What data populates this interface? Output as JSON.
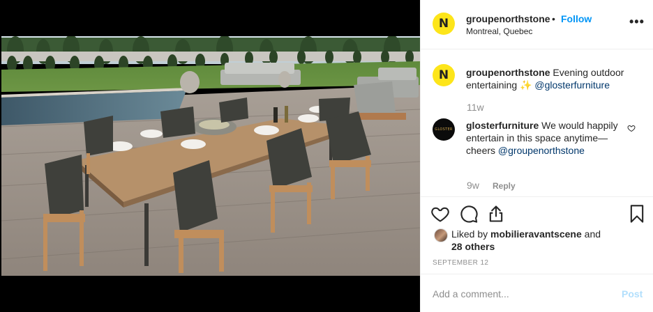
{
  "post": {
    "username": "groupenorthstone",
    "separator": "•",
    "follow_label": "Follow",
    "location": "Montreal, Quebec",
    "more_icon": "ellipsis-icon",
    "more_label": "•••",
    "avatar_letter": "N",
    "avatar_color": "#fde51a",
    "image": "outdoor-dining-table-photo"
  },
  "caption": {
    "username": "groupenorthstone",
    "text": " Evening outdoor entertaining ✨ ",
    "mention": "@glosterfurniture",
    "time": "11w"
  },
  "comments": [
    {
      "username": "glosterfurniture",
      "avatar_label": "GLOSTER",
      "text": " We would happily entertain in this space anytime—cheers ",
      "mention": "@groupenorthstone",
      "time": "9w",
      "reply_label": "Reply"
    }
  ],
  "actions": {
    "like_icon": "heart-icon",
    "comment_icon": "comment-icon",
    "share_icon": "share-icon",
    "save_icon": "bookmark-icon"
  },
  "likes": {
    "prefix": "Liked by ",
    "user": "mobilieravantscene",
    "middle": " and",
    "others": "28 others"
  },
  "date": "SEPTEMBER 12",
  "add_comment": {
    "placeholder": "Add a comment...",
    "post_label": "Post"
  },
  "colors": {
    "accent": "#0095f6",
    "mention": "#00376b",
    "muted": "#8e8e8e",
    "post_disabled": "#b2dffc"
  }
}
